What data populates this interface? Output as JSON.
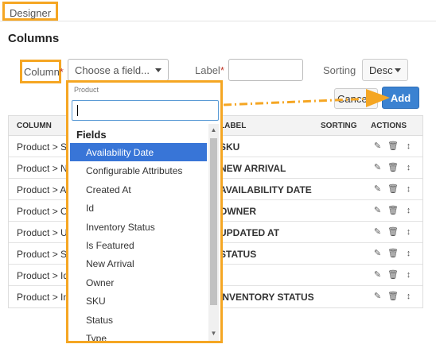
{
  "topbar": {
    "designer_tab": "Designer"
  },
  "section": {
    "heading": "Columns"
  },
  "form": {
    "column_label": "Column",
    "required_mark": "*",
    "column_placeholder": "Choose a field...",
    "label_label": "Label",
    "label_value": "",
    "sorting_label": "Sorting",
    "sorting_value": "Desc",
    "cancel_label": "Cancel",
    "add_label": "Add"
  },
  "table": {
    "headers": {
      "column": "COLUMN",
      "label": "LABEL",
      "sorting": "SORTING",
      "actions": "ACTIONS"
    },
    "rows": [
      {
        "column": "Product > SKU",
        "label": "SKU"
      },
      {
        "column": "Product > New Arrival",
        "label": "NEW ARRIVAL"
      },
      {
        "column": "Product > Availability Date",
        "label": "AVAILABILITY DATE"
      },
      {
        "column": "Product > Owner",
        "label": "OWNER"
      },
      {
        "column": "Product > Updated At",
        "label": "UPDATED AT"
      },
      {
        "column": "Product > Status",
        "label": "STATUS"
      },
      {
        "column": "Product > Id",
        "label": ""
      },
      {
        "column": "Product > Inventory Status",
        "label": "INVENTORY STATUS"
      }
    ],
    "action_icons": [
      "edit-icon",
      "trash-icon",
      "sort-handle-icon"
    ]
  },
  "dropdown": {
    "header": "Product",
    "search_value": "",
    "group_label": "Fields",
    "items": [
      "Availability Date",
      "Configurable Attributes",
      "Created At",
      "Id",
      "Inventory Status",
      "Is Featured",
      "New Arrival",
      "Owner",
      "SKU",
      "Status",
      "Type"
    ],
    "active_index": 0
  },
  "colors": {
    "highlight": "#f5a623",
    "primary_button": "#3b82d1",
    "active_item": "#3875d7"
  }
}
